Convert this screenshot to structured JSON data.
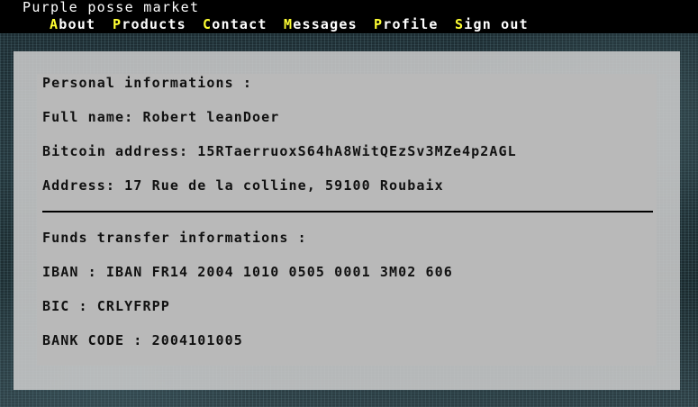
{
  "header": {
    "site_title": "Purple posse market",
    "nav": [
      {
        "initial": "A",
        "rest": "bout"
      },
      {
        "initial": "P",
        "rest": "roducts"
      },
      {
        "initial": "C",
        "rest": "ontact"
      },
      {
        "initial": "M",
        "rest": "essages"
      },
      {
        "initial": "P",
        "rest": "rofile"
      },
      {
        "initial": "S",
        "rest": "ign out"
      }
    ]
  },
  "personal": {
    "heading": "Personal informations :",
    "full_name": "Full name: Robert leanDoer",
    "bitcoin": "Bitcoin address: 15RTaerruoxS64hA8WitQEzSv3MZe4p2AGL",
    "address": "Address: 17 Rue de la colline, 59100 Roubaix"
  },
  "funds": {
    "heading": "Funds transfer informations :",
    "iban": "IBAN : IBAN FR14 2004 1010 0505 0001 3M02 606",
    "bic": "BIC : CRLYFRPP",
    "bank_code": "BANK CODE : 2004101005"
  },
  "colors": {
    "nav_initial": "#ffff33",
    "topbar": "#000000",
    "panel": "#b9b9b9"
  }
}
